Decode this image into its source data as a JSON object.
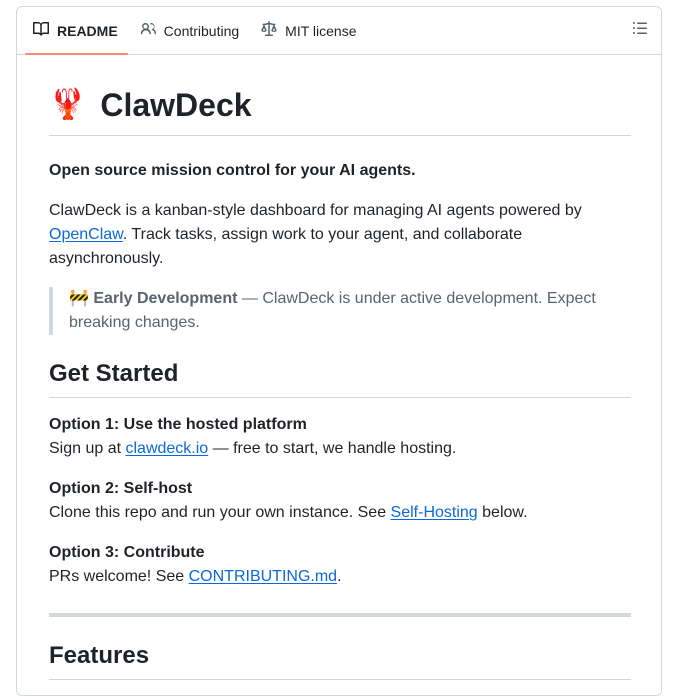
{
  "tabs": [
    {
      "label": "README",
      "icon": "book-icon",
      "active": true
    },
    {
      "label": "Contributing",
      "icon": "people-icon",
      "active": false
    },
    {
      "label": "MIT license",
      "icon": "law-scale-icon",
      "active": false
    }
  ],
  "outline_icon": "list-unordered-icon",
  "readme": {
    "title_emoji": "🦞",
    "title": "ClawDeck",
    "tagline": "Open source mission control for your AI agents.",
    "intro_before": "ClawDeck is a kanban-style dashboard for managing AI agents powered by ",
    "intro_link": "OpenClaw",
    "intro_after": ". Track tasks, assign work to your agent, and collaborate asynchronously.",
    "note_emoji": "🚧",
    "note_bold": "Early Development",
    "note_text": " — ClawDeck is under active development. Expect breaking changes.",
    "get_started": "Get Started",
    "option1_title": "Option 1: Use the hosted platform",
    "option1_before": "Sign up at ",
    "option1_link": "clawdeck.io",
    "option1_after": " — free to start, we handle hosting.",
    "option2_title": "Option 2: Self-host",
    "option2_before": "Clone this repo and run your own instance. See ",
    "option2_link": "Self-Hosting",
    "option2_after": " below.",
    "option3_title": "Option 3: Contribute",
    "option3_before": "PRs welcome! See ",
    "option3_link": "CONTRIBUTING.md",
    "option3_after": ".",
    "features": "Features"
  },
  "colors": {
    "active_tab_underline": "#fd8c73",
    "link": "#0969da",
    "border": "#d1d9e0",
    "muted_text": "#59636e"
  }
}
